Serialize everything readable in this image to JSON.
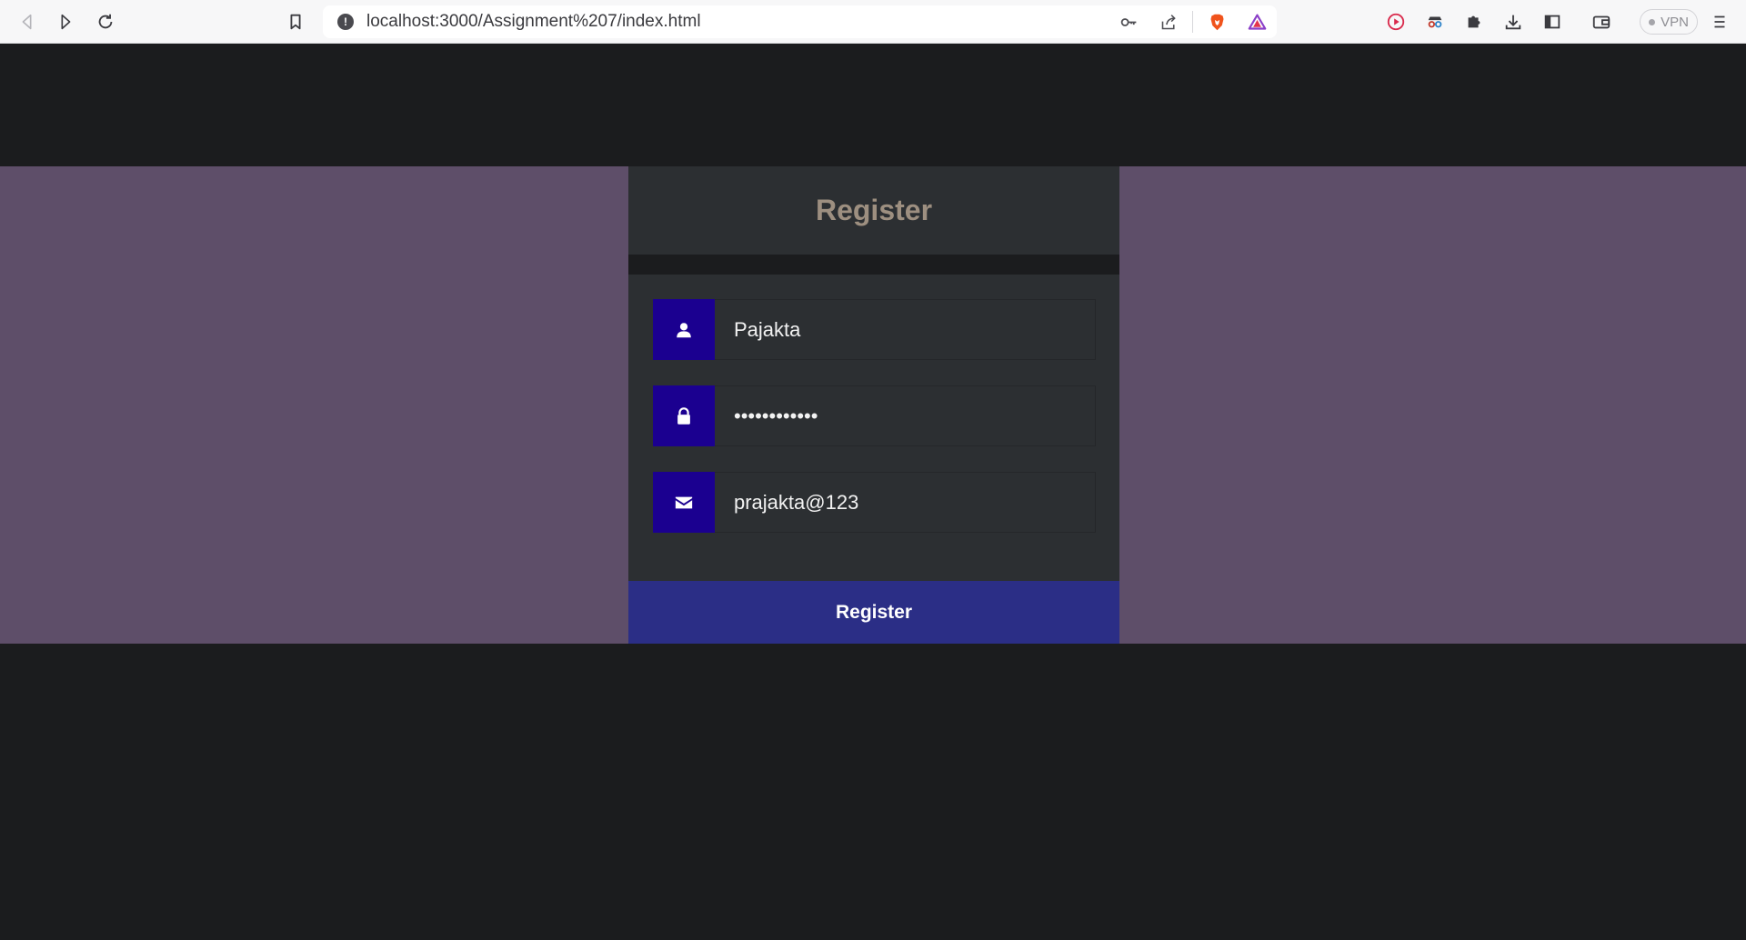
{
  "browser": {
    "url": "localhost:3000/Assignment%207/index.html",
    "vpn_label": "VPN"
  },
  "form": {
    "title": "Register",
    "fields": [
      {
        "icon": "user-icon",
        "value": "Pajakta"
      },
      {
        "icon": "lock-icon",
        "value": "••••••••••••"
      },
      {
        "icon": "envelope-icon",
        "value": "prajakta@123"
      }
    ],
    "submit_label": "Register"
  },
  "colors": {
    "page_bg": "#1b1c1e",
    "band_bg": "#5e4e69",
    "card_bg": "#2c2f32",
    "title_color": "#9d8f80",
    "icon_box_bg": "#1b0090",
    "submit_bg": "#2b2e86"
  }
}
